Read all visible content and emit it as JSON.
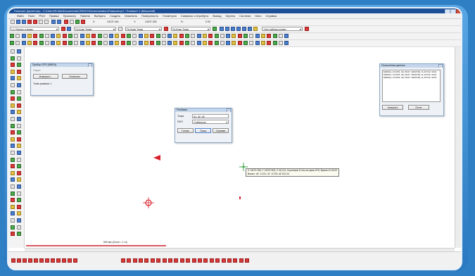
{
  "window": {
    "title": "Планшет Диспетчер - C:\\Users\\Public\\Documents\\CREDO\\Demonstration\\Планшет.prf - Планшет 1 (Масштаб)"
  },
  "menu": [
    "Файл",
    "Поле",
    "PDO",
    "Правка",
    "Просмотр",
    "Панели",
    "Выбрать",
    "Создать",
    "Изменить",
    "Поверхность",
    "Геометрия",
    "Символы и Атрибуты",
    "Вывод",
    "Чертеж",
    "Система",
    "Окно",
    "Справка"
  ],
  "toolbar": {
    "coords_label": "X:",
    "coord_x": "13137.404",
    "coord_y_label": "Y:",
    "coord_y": "13237.325",
    "coord_h_label": "H:",
    "coord_h": "0.00",
    "layer_select": "1.1 Пункты и знаки",
    "code_select": "По Коду Точки",
    "code_select2": "По Коду Точки",
    "linetype_select": "По Коду Точки",
    "selection_select": "<Нет набора слоев>"
  },
  "gps_panel": {
    "title": "Прибор GPS (NMEA)",
    "status": "Отдых",
    "measure_btn": "Измерить...",
    "stop_btn": "Отменить",
    "points_label": "Точек режима: 1"
  },
  "received_panel": {
    "title": "Полученные данные",
    "rows": [
      "$GPGGA,111254.00,5947.0860790,N,03742.9311",
      "$GPGGA,111255.00,5947.0860790,N,03742.9311",
      "$GPGGA,111256.00,5947.0860790,N,03742.9311"
    ],
    "copy_btn": "Записать",
    "clear_btn": "Отчет"
  },
  "dialog": {
    "title": "Разбивка",
    "row1_label": "Точка",
    "row1_value": "d1; d2; d3",
    "row2_label": "ПОЛ",
    "row2_value": "Стабильно",
    "btn_ready": "Готово",
    "btn_point": "Точка",
    "btn_help": "Справка"
  },
  "tooltip": {
    "line1": "Х 13137.206; Y 13237.823; Z 312.24; Спутников 8; Кол-во фикс 876; Время 11:04:00",
    "line2": "Вынос: dX -0.121; dY -0.276; dZ 312.24"
  },
  "status": {
    "scale_text": "500 мм (Zoom = 1 m)"
  },
  "colors": {
    "titlebar": "#1c4f95",
    "marker_red": "#d8202c",
    "marker_green": "#3ea64a",
    "scale_bar": "#c8202c",
    "frame": "#2f7fc4"
  }
}
